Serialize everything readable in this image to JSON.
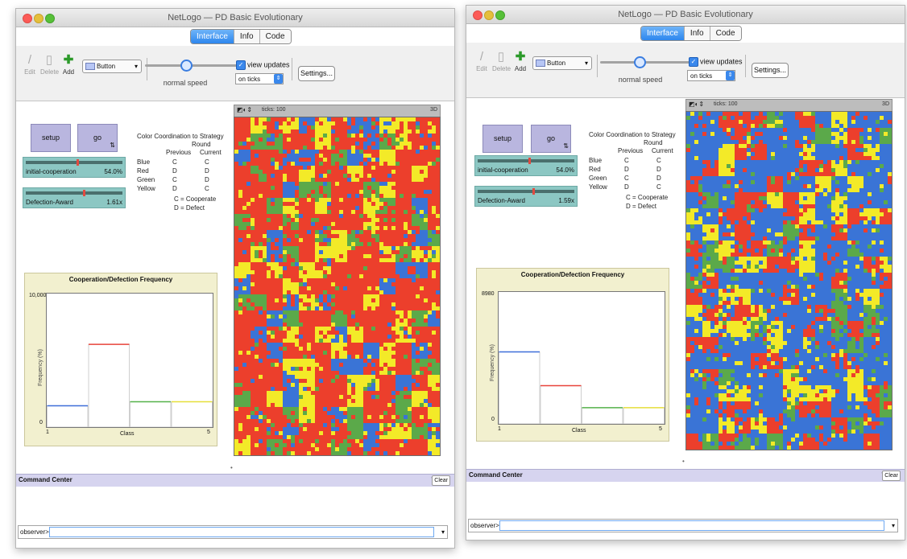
{
  "windows": [
    {
      "title": "NetLogo — PD Basic Evolutionary",
      "tabs": [
        "Interface",
        "Info",
        "Code"
      ],
      "active_tab": "Interface",
      "toolbar": {
        "edit_label": "Edit",
        "delete_label": "Delete",
        "add_label": "Add",
        "widget_type": "Button",
        "speed_label": "normal speed",
        "speed_fraction": 0.5,
        "view_updates_label": "view updates",
        "view_updates_checked": true,
        "update_mode": "on ticks",
        "settings_label": "Settings..."
      },
      "buttons": {
        "setup": "setup",
        "go": "go",
        "go_forever_icon": "forever-icon"
      },
      "sliders": [
        {
          "name": "initial-cooperation",
          "value": "54.0%",
          "fraction": 0.54
        },
        {
          "name": "Defection-Award",
          "value": "1.61x",
          "fraction": 0.61
        }
      ],
      "legend": {
        "title": "Color Coordination to Strategy",
        "subtitle": "Round",
        "col_previous": "Previous",
        "col_current": "Current",
        "rows": [
          {
            "color": "Blue",
            "previous": "C",
            "current": "C"
          },
          {
            "color": "Red",
            "previous": "D",
            "current": "D"
          },
          {
            "color": "Green",
            "previous": "C",
            "current": "D"
          },
          {
            "color": "Yellow",
            "previous": "D",
            "current": "C"
          }
        ],
        "note_c": "C = Cooperate",
        "note_d": "D = Defect"
      },
      "plot": {
        "title": "Cooperation/Defection Frequency",
        "ylabel": "Frequency (%)",
        "xlabel": "Class",
        "ymax": "10,000",
        "ymin": "0",
        "xmin": "1",
        "xmax": "5"
      },
      "chart_data": {
        "type": "bar",
        "title": "Cooperation/Defection Frequency",
        "xlabel": "Class",
        "ylabel": "Frequency (%)",
        "categories": [
          "1",
          "2",
          "3",
          "4"
        ],
        "values": [
          1600,
          6200,
          1900,
          1900
        ],
        "colors": [
          "#3f6fd9",
          "#e8433a",
          "#55b24a",
          "#e6df3a"
        ],
        "ylim": [
          0,
          10000
        ],
        "xlim": [
          1,
          5
        ]
      },
      "world": {
        "ticks_label": "ticks: 100",
        "palette": {
          "blue": "#3a74d6",
          "red": "#ec3f2c",
          "green": "#5ba94a",
          "yellow": "#f3ea28"
        },
        "proportions": {
          "blue": 0.13,
          "red": 0.56,
          "green": 0.13,
          "yellow": 0.18
        },
        "seed": 7
      },
      "command_center": {
        "title": "Command Center",
        "clear_label": "Clear",
        "observer_label": "observer>"
      }
    },
    {
      "title": "NetLogo — PD Basic Evolutionary",
      "tabs": [
        "Interface",
        "Info",
        "Code"
      ],
      "active_tab": "Interface",
      "toolbar": {
        "edit_label": "Edit",
        "delete_label": "Delete",
        "add_label": "Add",
        "widget_type": "Button",
        "speed_label": "normal speed",
        "speed_fraction": 0.5,
        "view_updates_label": "view updates",
        "view_updates_checked": true,
        "update_mode": "on ticks",
        "settings_label": "Settings..."
      },
      "buttons": {
        "setup": "setup",
        "go": "go",
        "go_forever_icon": "forever-icon"
      },
      "sliders": [
        {
          "name": "initial-cooperation",
          "value": "54.0%",
          "fraction": 0.54
        },
        {
          "name": "Defection-Award",
          "value": "1.59x",
          "fraction": 0.59
        }
      ],
      "legend": {
        "title": "Color Coordination to Strategy",
        "subtitle": "Round",
        "col_previous": "Previous",
        "col_current": "Current",
        "rows": [
          {
            "color": "Blue",
            "previous": "C",
            "current": "C"
          },
          {
            "color": "Red",
            "previous": "D",
            "current": "D"
          },
          {
            "color": "Green",
            "previous": "C",
            "current": "D"
          },
          {
            "color": "Yellow",
            "previous": "D",
            "current": "C"
          }
        ],
        "note_c": "C = Cooperate",
        "note_d": "D = Defect"
      },
      "plot": {
        "title": "Cooperation/Defection Frequency",
        "ylabel": "Frequency (%)",
        "xlabel": "Class",
        "ymax": "8980",
        "ymin": "0",
        "xmin": "1",
        "xmax": "5"
      },
      "chart_data": {
        "type": "bar",
        "title": "Cooperation/Defection Frequency",
        "xlabel": "Class",
        "ylabel": "Frequency (%)",
        "categories": [
          "1",
          "2",
          "3",
          "4"
        ],
        "values": [
          4900,
          2600,
          1100,
          1100
        ],
        "colors": [
          "#3f6fd9",
          "#e8433a",
          "#55b24a",
          "#e6df3a"
        ],
        "ylim": [
          0,
          8980
        ],
        "xlim": [
          1,
          5
        ]
      },
      "world": {
        "ticks_label": "ticks: 100",
        "palette": {
          "blue": "#3a74d6",
          "red": "#ec3f2c",
          "green": "#5ba94a",
          "yellow": "#f3ea28"
        },
        "proportions": {
          "blue": 0.5,
          "red": 0.22,
          "green": 0.12,
          "yellow": 0.16
        },
        "seed": 23
      },
      "command_center": {
        "title": "Command Center",
        "clear_label": "Clear",
        "observer_label": "observer>"
      }
    }
  ]
}
